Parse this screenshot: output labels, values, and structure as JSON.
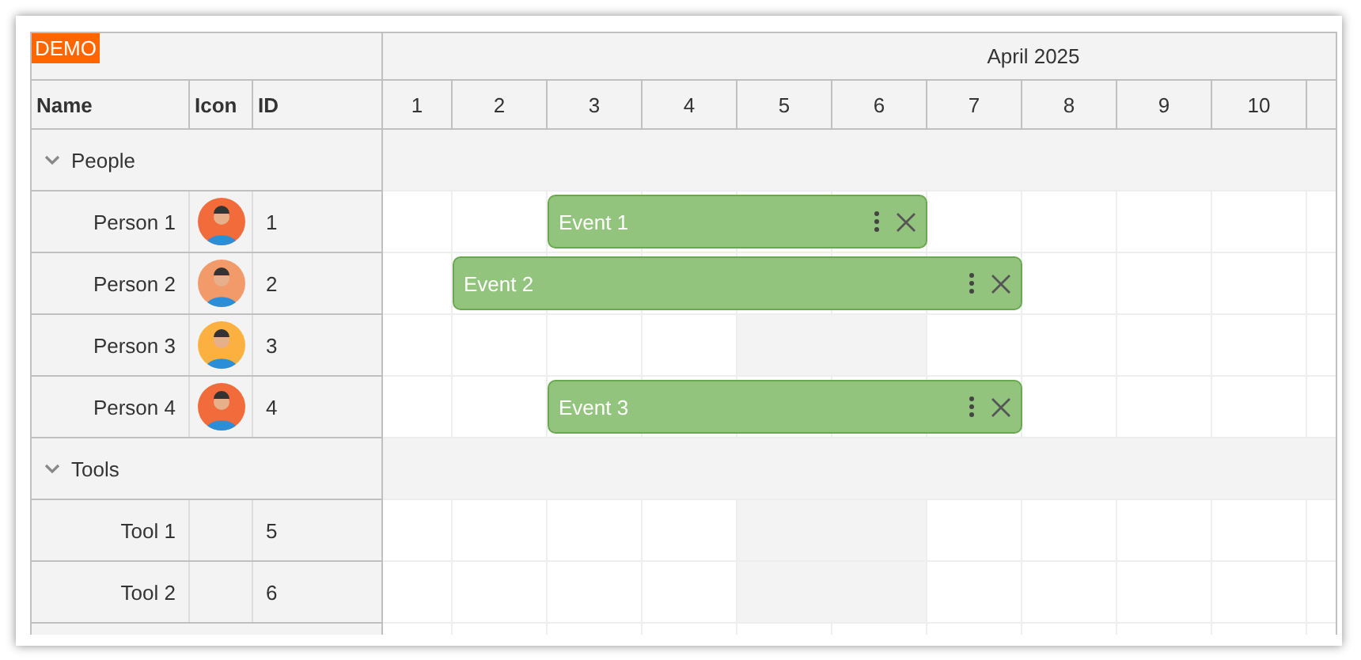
{
  "badge": "DEMO",
  "columns": [
    "Name",
    "Icon",
    "ID"
  ],
  "month": "April 2025",
  "days": [
    {
      "label": "1",
      "weekend": false
    },
    {
      "label": "2",
      "weekend": false
    },
    {
      "label": "3",
      "weekend": false
    },
    {
      "label": "4",
      "weekend": false
    },
    {
      "label": "5",
      "weekend": true
    },
    {
      "label": "6",
      "weekend": true
    },
    {
      "label": "7",
      "weekend": false
    },
    {
      "label": "8",
      "weekend": false
    },
    {
      "label": "9",
      "weekend": false
    },
    {
      "label": "10",
      "weekend": false
    }
  ],
  "groups": [
    {
      "name": "People",
      "expanded": true,
      "children": [
        {
          "name": "Person 1",
          "id": "1",
          "color": "#f26b3a",
          "events": [
            {
              "text": "Event 1"
            }
          ]
        },
        {
          "name": "Person 2",
          "id": "2",
          "color": "#f39a6b",
          "events": [
            {
              "text": "Event 2"
            }
          ]
        },
        {
          "name": "Person 3",
          "id": "3",
          "color": "#fbb040"
        },
        {
          "name": "Person 4",
          "id": "4",
          "color": "#f26b3a",
          "events": [
            {
              "text": "Event 3"
            }
          ]
        }
      ]
    },
    {
      "name": "Tools",
      "expanded": true,
      "children": [
        {
          "name": "Tool 1",
          "id": "5"
        },
        {
          "name": "Tool 2",
          "id": "6"
        }
      ]
    }
  ]
}
